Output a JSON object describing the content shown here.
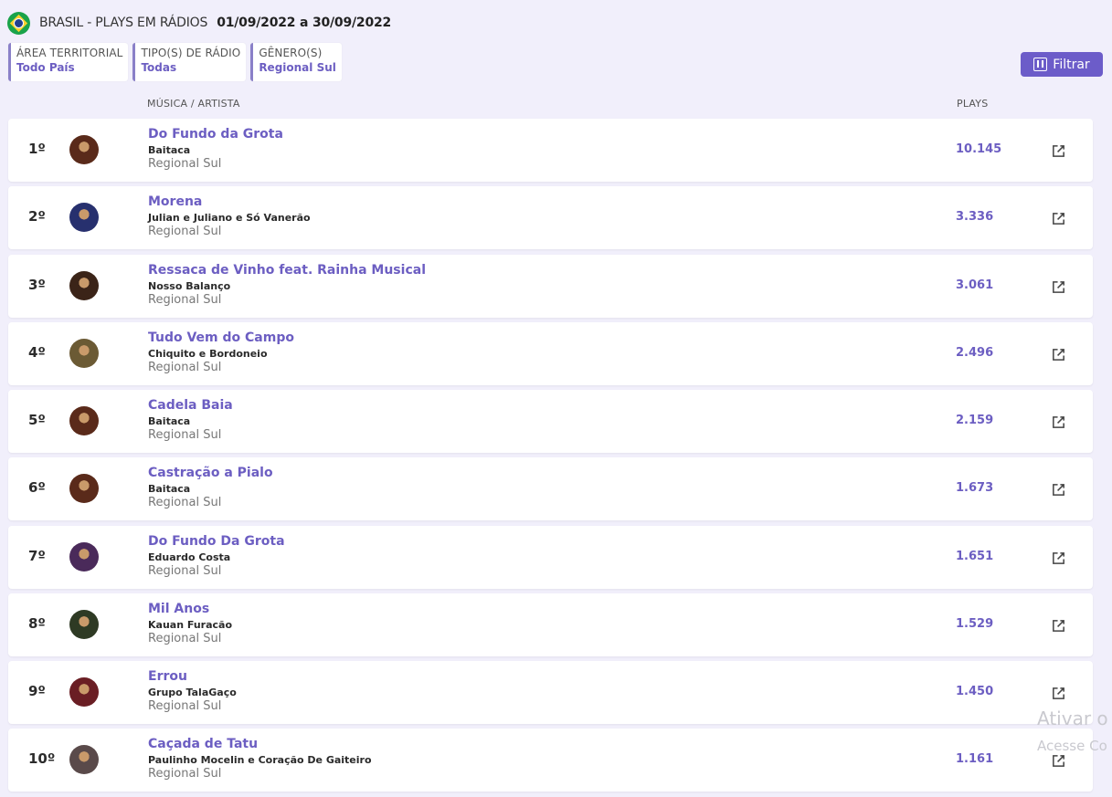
{
  "header": {
    "flag_icon": "brazil-flag-icon",
    "title": "BRASIL - PLAYS EM RÁDIOS",
    "dates": "01/09/2022 a 30/09/2022"
  },
  "filters": [
    {
      "label": "ÁREA TERRITORIAL",
      "value": "Todo País"
    },
    {
      "label": "TIPO(S) DE RÁDIO",
      "value": "Todas"
    },
    {
      "label": "GÊNERO(S)",
      "value": "Regional Sul"
    }
  ],
  "filter_button": {
    "label": "Filtrar",
    "icon": "sliders-icon"
  },
  "columns": {
    "music_artist": "MÚSICA / ARTISTA",
    "plays": "PLAYS"
  },
  "rows": [
    {
      "rank": "1º",
      "song": "Do Fundo da Grota",
      "artist": "Baitaca",
      "genre": "Regional Sul",
      "plays": "10.145"
    },
    {
      "rank": "2º",
      "song": "Morena",
      "artist": "Julian e Juliano e Só Vanerão",
      "genre": "Regional Sul",
      "plays": "3.336"
    },
    {
      "rank": "3º",
      "song": "Ressaca de Vinho feat. Rainha Musical",
      "artist": "Nosso Balanço",
      "genre": "Regional Sul",
      "plays": "3.061"
    },
    {
      "rank": "4º",
      "song": "Tudo Vem do Campo",
      "artist": "Chiquito e Bordoneio",
      "genre": "Regional Sul",
      "plays": "2.496"
    },
    {
      "rank": "5º",
      "song": "Cadela Baia",
      "artist": "Baitaca",
      "genre": "Regional Sul",
      "plays": "2.159"
    },
    {
      "rank": "6º",
      "song": "Castração a Pialo",
      "artist": "Baitaca",
      "genre": "Regional Sul",
      "plays": "1.673"
    },
    {
      "rank": "7º",
      "song": "Do Fundo Da Grota",
      "artist": "Eduardo Costa",
      "genre": "Regional Sul",
      "plays": "1.651"
    },
    {
      "rank": "8º",
      "song": "Mil Anos",
      "artist": "Kauan Furacão",
      "genre": "Regional Sul",
      "plays": "1.529"
    },
    {
      "rank": "9º",
      "song": "Errou",
      "artist": "Grupo TalaGaço",
      "genre": "Regional Sul",
      "plays": "1.450"
    },
    {
      "rank": "10º",
      "song": "Caçada de Tatu",
      "artist": "Paulinho Mocelin e Coração De Gaiteiro",
      "genre": "Regional Sul",
      "plays": "1.161"
    }
  ],
  "avatar_colors": [
    "#5a2a1a",
    "#27306e",
    "#3b2418",
    "#6b5a34",
    "#5a2a1a",
    "#5a2a1a",
    "#4a2a5a",
    "#2e3a24",
    "#6a1e24",
    "#5a4a4a"
  ],
  "watermark": {
    "line1": "Ativar o",
    "line2": "Acesse Co"
  },
  "colors": {
    "accent": "#6c5ec2",
    "background": "#f1effb",
    "button": "#6c5cc9"
  }
}
